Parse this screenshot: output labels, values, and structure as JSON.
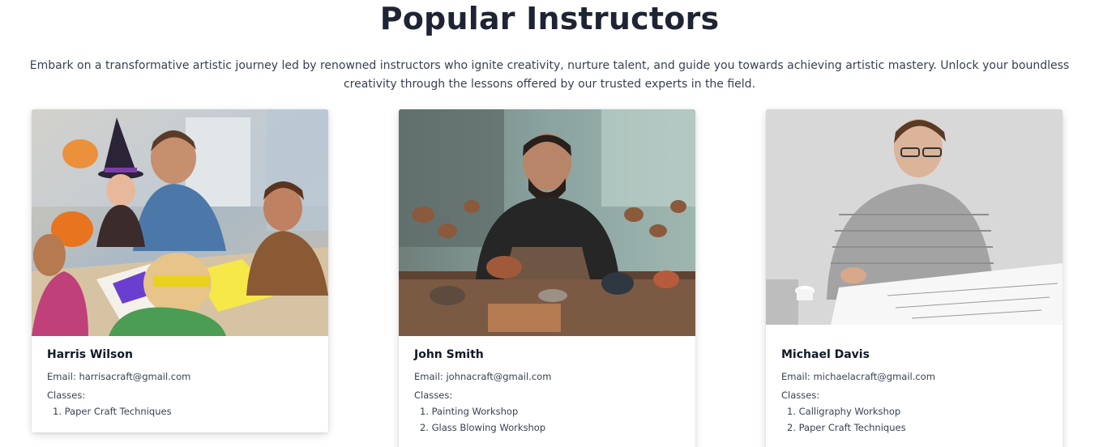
{
  "section": {
    "title": "Popular Instructors",
    "subtitle": "Embark on a transformative artistic journey led by renowned instructors who ignite creativity, nurture talent, and guide you towards achieving artistic mastery. Unlock your boundless creativity through the lessons offered by our trusted experts in the field."
  },
  "instructors": [
    {
      "name": "Harris Wilson",
      "email_label": "Email:",
      "email": "harrisacraft@gmail.com",
      "classes_label": "Classes:",
      "classes": [
        "1. Paper Craft Techniques"
      ],
      "photo_icon": "instructor-photo-kids-craft"
    },
    {
      "name": "John Smith",
      "email_label": "Email:",
      "email": "johnacraft@gmail.com",
      "classes_label": "Classes:",
      "classes": [
        "1. Painting Workshop",
        "2. Glass Blowing Workshop"
      ],
      "photo_icon": "instructor-photo-pottery"
    },
    {
      "name": "Michael Davis",
      "email_label": "Email:",
      "email": "michaelacraft@gmail.com",
      "classes_label": "Classes:",
      "classes": [
        "1. Calligraphy Workshop",
        "2. Paper Craft Techniques"
      ],
      "photo_icon": "instructor-photo-drawing"
    }
  ],
  "colors": {
    "title": "#1e2433",
    "text": "#374151",
    "card_bg": "#ffffff"
  }
}
